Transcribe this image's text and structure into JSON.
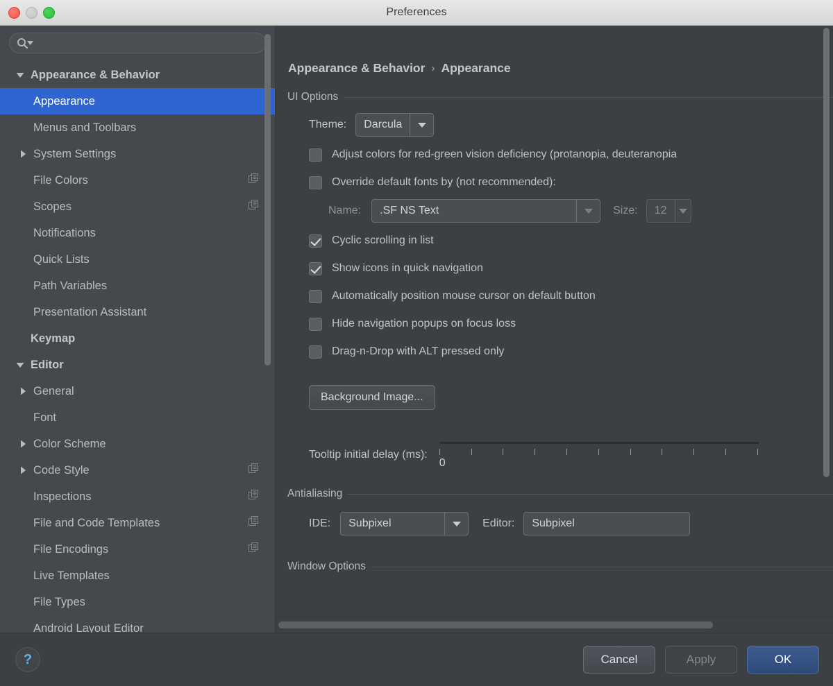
{
  "window": {
    "title": "Preferences",
    "traffic_lights": [
      "close",
      "minimize",
      "zoom"
    ]
  },
  "search": {
    "value": "",
    "placeholder": ""
  },
  "sidebar": {
    "items": [
      {
        "label": "Appearance & Behavior",
        "level": 0,
        "twisty": "down",
        "bold": true,
        "selected": false,
        "copy": false
      },
      {
        "label": "Appearance",
        "level": 1,
        "twisty": "none",
        "bold": false,
        "selected": true,
        "copy": false
      },
      {
        "label": "Menus and Toolbars",
        "level": 1,
        "twisty": "none",
        "bold": false,
        "selected": false,
        "copy": false
      },
      {
        "label": "System Settings",
        "level": 1,
        "twisty": "right",
        "bold": false,
        "selected": false,
        "copy": false
      },
      {
        "label": "File Colors",
        "level": 1,
        "twisty": "none",
        "bold": false,
        "selected": false,
        "copy": true
      },
      {
        "label": "Scopes",
        "level": 1,
        "twisty": "none",
        "bold": false,
        "selected": false,
        "copy": true
      },
      {
        "label": "Notifications",
        "level": 1,
        "twisty": "none",
        "bold": false,
        "selected": false,
        "copy": false
      },
      {
        "label": "Quick Lists",
        "level": 1,
        "twisty": "none",
        "bold": false,
        "selected": false,
        "copy": false
      },
      {
        "label": "Path Variables",
        "level": 1,
        "twisty": "none",
        "bold": false,
        "selected": false,
        "copy": false
      },
      {
        "label": "Presentation Assistant",
        "level": 1,
        "twisty": "none",
        "bold": false,
        "selected": false,
        "copy": false
      },
      {
        "label": "Keymap",
        "level": 0,
        "twisty": "none",
        "bold": true,
        "selected": false,
        "copy": false
      },
      {
        "label": "Editor",
        "level": 0,
        "twisty": "down",
        "bold": true,
        "selected": false,
        "copy": false
      },
      {
        "label": "General",
        "level": 1,
        "twisty": "right",
        "bold": false,
        "selected": false,
        "copy": false
      },
      {
        "label": "Font",
        "level": 1,
        "twisty": "none",
        "bold": false,
        "selected": false,
        "copy": false
      },
      {
        "label": "Color Scheme",
        "level": 1,
        "twisty": "right",
        "bold": false,
        "selected": false,
        "copy": false
      },
      {
        "label": "Code Style",
        "level": 1,
        "twisty": "right",
        "bold": false,
        "selected": false,
        "copy": true
      },
      {
        "label": "Inspections",
        "level": 1,
        "twisty": "none",
        "bold": false,
        "selected": false,
        "copy": true
      },
      {
        "label": "File and Code Templates",
        "level": 1,
        "twisty": "none",
        "bold": false,
        "selected": false,
        "copy": true
      },
      {
        "label": "File Encodings",
        "level": 1,
        "twisty": "none",
        "bold": false,
        "selected": false,
        "copy": true
      },
      {
        "label": "Live Templates",
        "level": 1,
        "twisty": "none",
        "bold": false,
        "selected": false,
        "copy": false
      },
      {
        "label": "File Types",
        "level": 1,
        "twisty": "none",
        "bold": false,
        "selected": false,
        "copy": false
      },
      {
        "label": "Android Layout Editor",
        "level": 1,
        "twisty": "none",
        "bold": false,
        "selected": false,
        "copy": false
      }
    ]
  },
  "panel": {
    "breadcrumb": {
      "parent": "Appearance & Behavior",
      "separator": "›",
      "current": "Appearance"
    },
    "ui_options": {
      "title": "UI Options",
      "theme_label": "Theme:",
      "theme_value": "Darcula",
      "checkboxes": [
        {
          "label": "Adjust colors for red-green vision deficiency (protanopia, deuteranopia",
          "checked": false
        },
        {
          "label": "Override default fonts by (not recommended):",
          "checked": false
        },
        {
          "label": "Cyclic scrolling in list",
          "checked": true
        },
        {
          "label": "Show icons in quick navigation",
          "checked": true
        },
        {
          "label": "Automatically position mouse cursor on default button",
          "checked": false
        },
        {
          "label": "Hide navigation popups on focus loss",
          "checked": false
        },
        {
          "label": "Drag-n-Drop with ALT pressed only",
          "checked": false
        }
      ],
      "font_name_label": "Name:",
      "font_name_value": ".SF NS Text",
      "font_size_label": "Size:",
      "font_size_value": "12",
      "background_image_button": "Background Image...",
      "tooltip_delay_label": "Tooltip initial delay (ms):",
      "tooltip_delay_value": "0",
      "tooltip_tick_count": 11
    },
    "antialiasing": {
      "title": "Antialiasing",
      "ide_label": "IDE:",
      "ide_value": "Subpixel",
      "editor_label": "Editor:",
      "editor_value": "Subpixel"
    },
    "window_options": {
      "title": "Window Options"
    }
  },
  "footer": {
    "help_glyph": "?",
    "cancel_label": "Cancel",
    "apply_label": "Apply",
    "ok_label": "OK"
  },
  "colors": {
    "selection_blue": "#2f65d0",
    "default_button_blue": "#3d5c8e",
    "help_icon_blue": "#62b4e8",
    "panel_bg": "#3c4043",
    "sidebar_bg": "#45494e"
  }
}
